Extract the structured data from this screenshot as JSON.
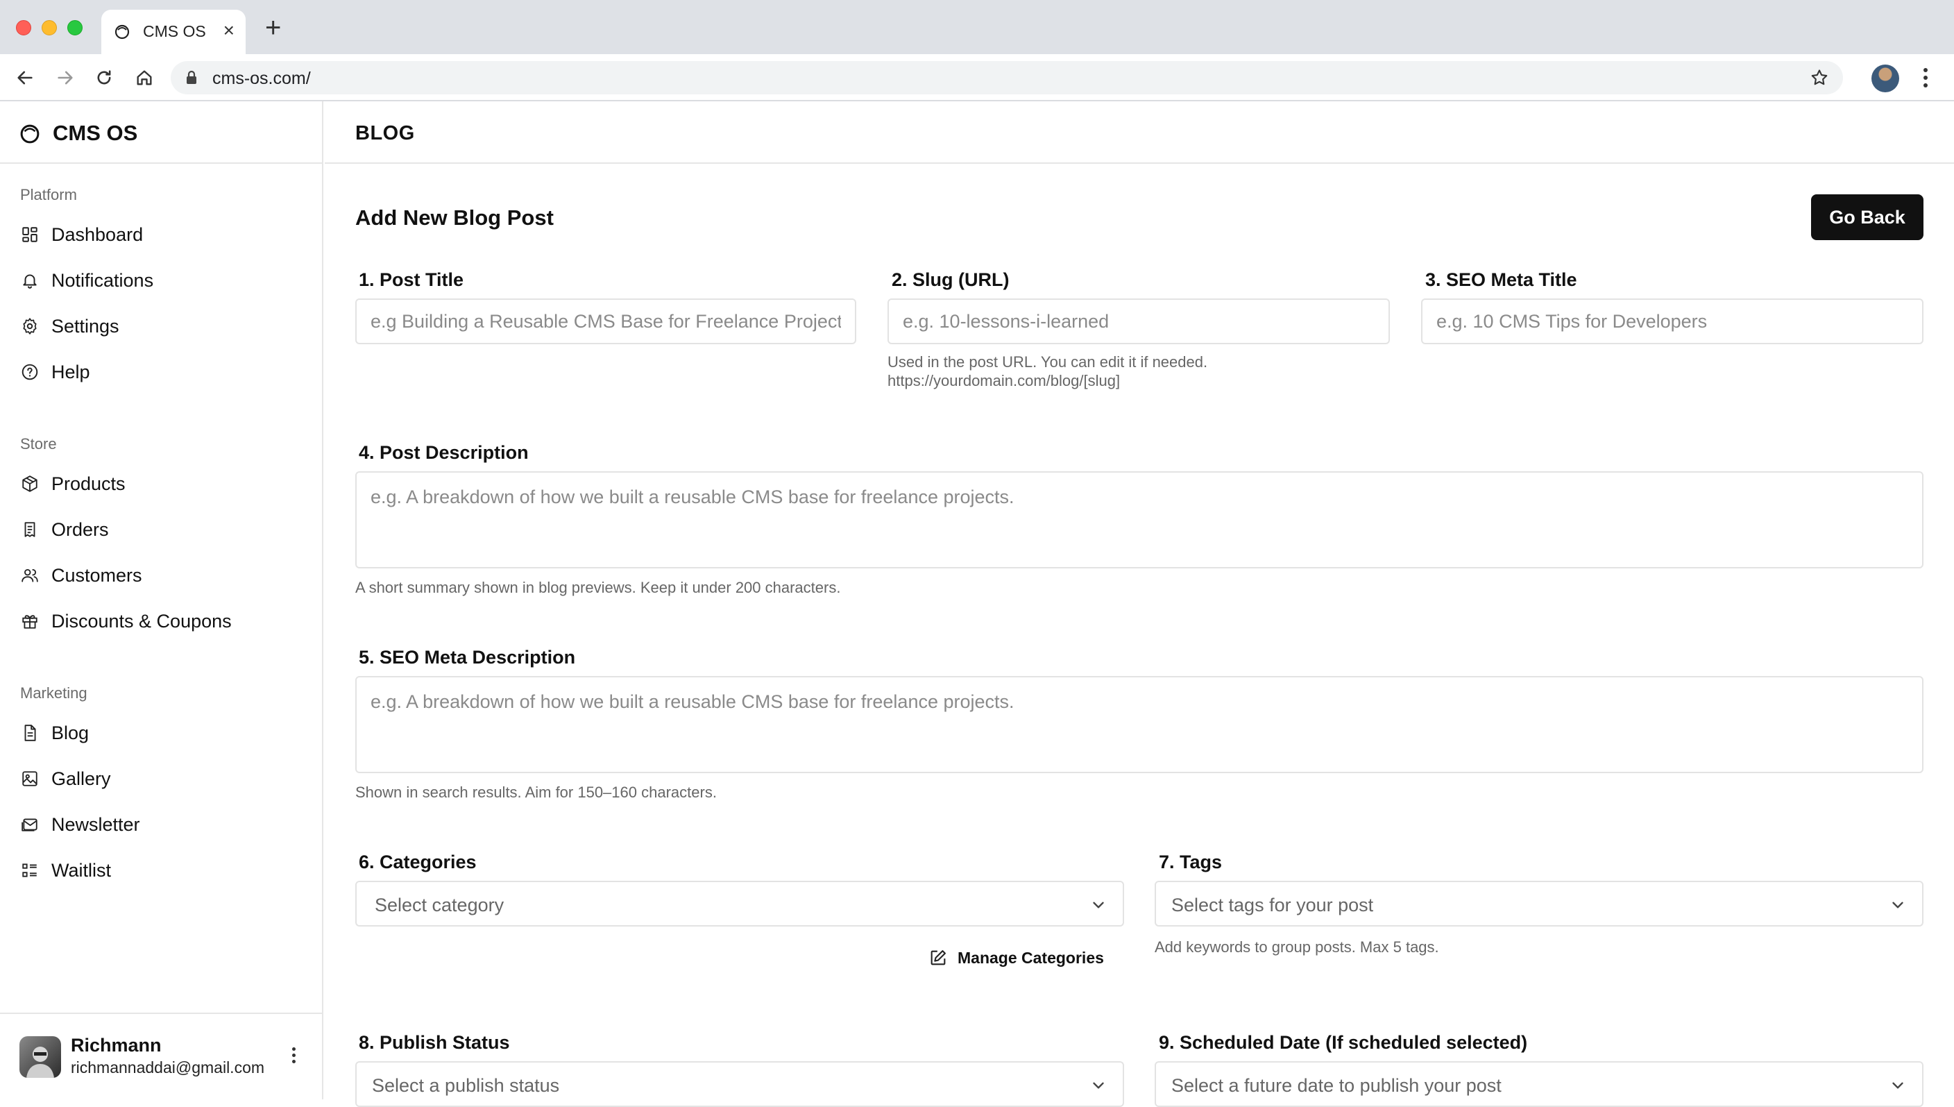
{
  "browser": {
    "tab_title": "CMS OS",
    "new_tab": "+",
    "close": "×",
    "url": "cms-os.com/"
  },
  "sidebar": {
    "brand": "CMS OS",
    "groups": [
      {
        "label": "Platform",
        "items": [
          {
            "label": "Dashboard",
            "icon": "dashboard-icon"
          },
          {
            "label": "Notifications",
            "icon": "bell-icon"
          },
          {
            "label": "Settings",
            "icon": "gear-icon"
          },
          {
            "label": "Help",
            "icon": "help-icon"
          }
        ]
      },
      {
        "label": "Store",
        "items": [
          {
            "label": "Products",
            "icon": "package-icon"
          },
          {
            "label": "Orders",
            "icon": "receipt-icon"
          },
          {
            "label": "Customers",
            "icon": "users-icon"
          },
          {
            "label": "Discounts & Coupons",
            "icon": "gift-icon"
          }
        ]
      },
      {
        "label": "Marketing",
        "items": [
          {
            "label": "Blog",
            "icon": "document-icon"
          },
          {
            "label": "Gallery",
            "icon": "image-icon"
          },
          {
            "label": "Newsletter",
            "icon": "mail-icon"
          },
          {
            "label": "Waitlist",
            "icon": "list-icon"
          }
        ]
      }
    ],
    "user": {
      "name": "Richmann",
      "email": "richmannaddai@gmail.com"
    }
  },
  "header": {
    "title": "BLOG"
  },
  "form": {
    "heading": "Add New Blog Post",
    "go_back": "Go Back",
    "post_title": {
      "label": "1. Post Title",
      "placeholder": "e.g Building a Reusable CMS Base for Freelance Projects"
    },
    "slug": {
      "label": "2. Slug (URL)",
      "placeholder": "e.g. 10-lessons-i-learned",
      "hint_line1": "Used in the post URL. You can edit it if needed.",
      "hint_line2": "https://yourdomain.com/blog/[slug]"
    },
    "seo_title": {
      "label": "3. SEO Meta Title",
      "placeholder": "e.g. 10 CMS Tips for Developers"
    },
    "description": {
      "label": "4. Post Description",
      "placeholder": "e.g. A breakdown of how we built a reusable CMS base for freelance projects.",
      "hint": "A short summary shown in blog previews. Keep it under 200 characters."
    },
    "seo_description": {
      "label": "5. SEO Meta Description",
      "placeholder": "e.g. A breakdown of how we built a reusable CMS base for freelance projects.",
      "hint": "Shown in search results. Aim for 150–160 characters."
    },
    "categories": {
      "label": "6. Categories",
      "value": "Select category",
      "manage": "Manage Categories"
    },
    "tags": {
      "label": "7. Tags",
      "value": "Select tags for your post",
      "hint": "Add keywords to group posts. Max 5 tags."
    },
    "publish_status": {
      "label": "8. Publish Status",
      "value": "Select a publish status"
    },
    "scheduled_date": {
      "label": "9. Scheduled Date (If scheduled selected)",
      "value": "Select a future date to publish your post"
    }
  }
}
